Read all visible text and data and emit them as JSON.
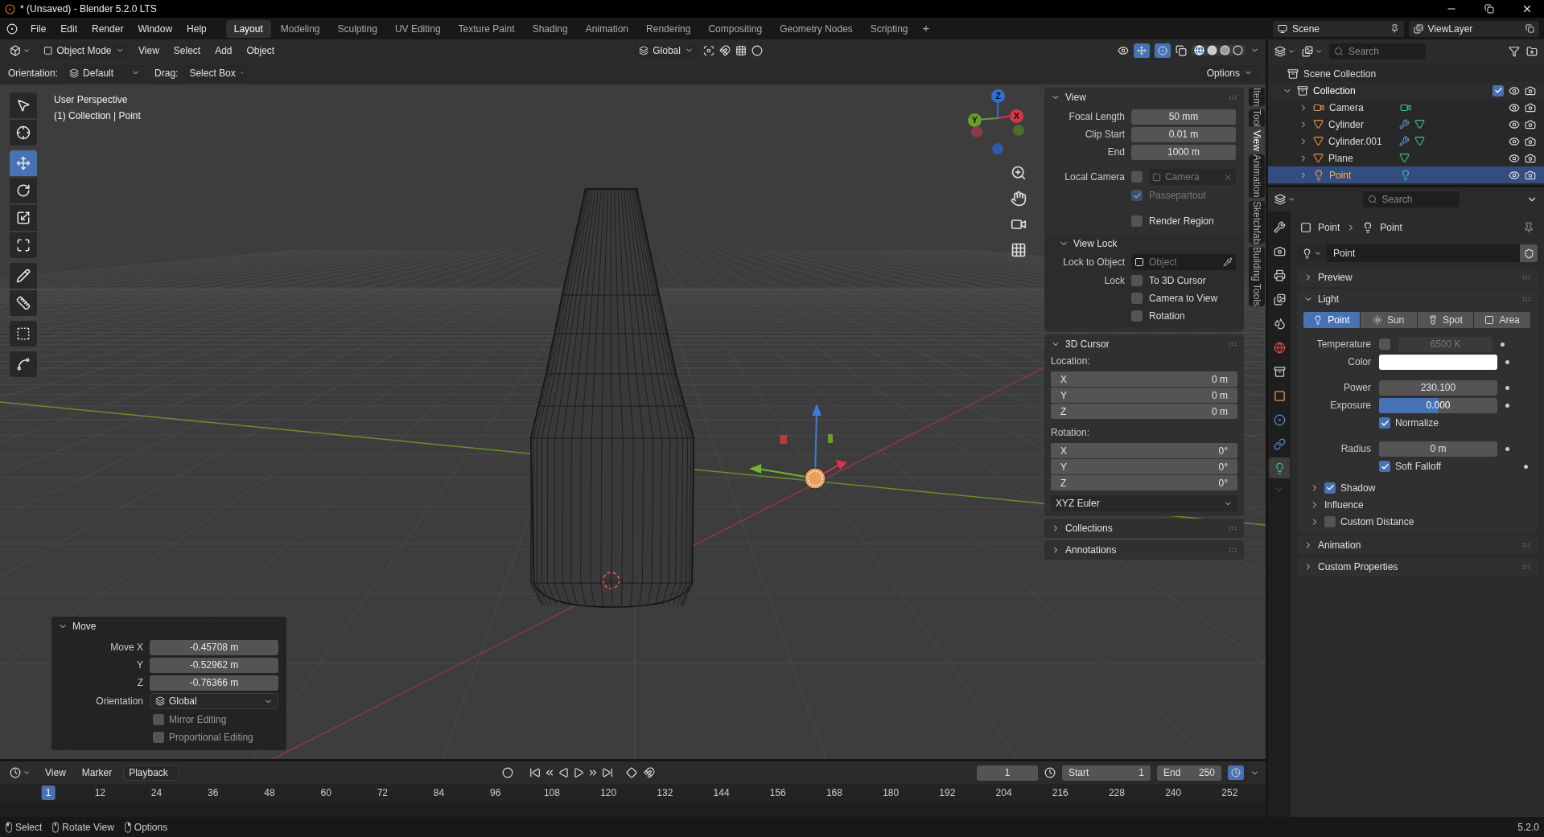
{
  "window": {
    "title": "* (Unsaved) - Blender 5.2.0 LTS"
  },
  "menus": [
    "File",
    "Edit",
    "Render",
    "Window",
    "Help"
  ],
  "workspaces": [
    {
      "label": "Layout",
      "selected": true
    },
    {
      "label": "Modeling",
      "selected": false
    },
    {
      "label": "Sculpting",
      "selected": false
    },
    {
      "label": "UV Editing",
      "selected": false
    },
    {
      "label": "Texture Paint",
      "selected": false
    },
    {
      "label": "Shading",
      "selected": false
    },
    {
      "label": "Animation",
      "selected": false
    },
    {
      "label": "Rendering",
      "selected": false
    },
    {
      "label": "Compositing",
      "selected": false
    },
    {
      "label": "Geometry Nodes",
      "selected": false
    },
    {
      "label": "Scripting",
      "selected": false
    }
  ],
  "add_workspace": "+",
  "scene": "Scene",
  "view_layer": "ViewLayer",
  "viewport_header": {
    "mode": "Object Mode",
    "menus": [
      "View",
      "Select",
      "Add",
      "Object"
    ],
    "transform_orientation": "Global"
  },
  "tool_settings": {
    "orientation_label": "Orientation:",
    "orientation": "Default",
    "drag_label": "Drag:",
    "drag": "Select Box",
    "options": "Options"
  },
  "toolbar": [
    [
      {
        "kind": "select",
        "selected": false
      },
      {
        "kind": "cursor",
        "selected": false
      }
    ],
    [
      {
        "kind": "move",
        "selected": true
      },
      {
        "kind": "rotate",
        "selected": false
      },
      {
        "kind": "scale",
        "selected": false
      },
      {
        "kind": "transform",
        "selected": false
      }
    ],
    [
      {
        "kind": "annotate",
        "selected": false
      },
      {
        "kind": "measure",
        "selected": false
      }
    ],
    [
      {
        "kind": "add_cube",
        "selected": false
      }
    ],
    [
      {
        "kind": "extrude_curve",
        "selected": false
      }
    ]
  ],
  "viewport_text": [
    "User Perspective",
    "(1) Collection | Point"
  ],
  "nav_axes": [
    {
      "label": "Z",
      "color": "#2f6fd6"
    },
    {
      "label": "Y",
      "color": "#6b9e2a"
    },
    {
      "label": "X",
      "color": "#d8344a"
    }
  ],
  "sidebar_tabs": [
    {
      "label": "Item",
      "selected": false
    },
    {
      "label": "Tool",
      "selected": false
    },
    {
      "label": "View",
      "selected": true
    },
    {
      "label": "Animation",
      "selected": false
    },
    {
      "label": "Sketchfab",
      "selected": false
    },
    {
      "label": "Building Tools",
      "selected": false
    }
  ],
  "view_panel": {
    "title": "View",
    "expanded": true,
    "lens": [
      {
        "label": "Focal Length",
        "value": "50 mm"
      },
      {
        "label": "Clip Start",
        "value": "0.01 m"
      },
      {
        "label": "End",
        "value": "1000 m"
      }
    ],
    "local_camera": {
      "label": "Local Camera",
      "checked": false,
      "placeholder": "Camera"
    },
    "passepartout": {
      "label": "Passepartout",
      "checked": true,
      "disabled": true
    },
    "render_region": {
      "label": "Render Region",
      "checked": false
    },
    "view_lock": {
      "title": "View Lock",
      "expanded": true,
      "lock_to_object_label": "Lock to Object",
      "object_placeholder": "Object",
      "lock_label": "Lock",
      "options": [
        {
          "label": "To 3D Cursor",
          "checked": false
        },
        {
          "label": "Camera to View",
          "checked": false
        },
        {
          "label": "Rotation",
          "checked": false
        }
      ]
    }
  },
  "cursor_panel": {
    "title": "3D Cursor",
    "expanded": true,
    "location_label": "Location:",
    "location": [
      {
        "axis": "X",
        "value": "0 m"
      },
      {
        "axis": "Y",
        "value": "0 m"
      },
      {
        "axis": "Z",
        "value": "0 m"
      }
    ],
    "rotation_label": "Rotation:",
    "rotation": [
      {
        "axis": "X",
        "value": "0°"
      },
      {
        "axis": "Y",
        "value": "0°"
      },
      {
        "axis": "Z",
        "value": "0°"
      }
    ],
    "rotation_mode": "XYZ Euler"
  },
  "sidebar_collapsed_panels": [
    {
      "title": "Collections",
      "expanded": false
    },
    {
      "title": "Annotations",
      "expanded": false
    }
  ],
  "move_panel": {
    "title": "Move",
    "expanded": true,
    "values": [
      {
        "label": "Move X",
        "value": "-0.45708 m"
      },
      {
        "label": "Y",
        "value": "-0.52962 m"
      },
      {
        "label": "Z",
        "value": "-0.76366 m"
      }
    ],
    "orientation_label": "Orientation",
    "orientation": "Global",
    "options": [
      {
        "label": "Mirror Editing",
        "checked": false
      },
      {
        "label": "Proportional Editing",
        "checked": false
      }
    ]
  },
  "outliner": {
    "search_placeholder": "Search",
    "root": "Scene Collection",
    "collection": {
      "name": "Collection",
      "expanded": true,
      "checked": true,
      "children": [
        {
          "name": "Camera",
          "kind": "camera",
          "selected": false,
          "has_modifier": false
        },
        {
          "name": "Cylinder",
          "kind": "mesh",
          "selected": false,
          "has_modifier": true
        },
        {
          "name": "Cylinder.001",
          "kind": "mesh",
          "selected": false,
          "has_modifier": true
        },
        {
          "name": "Plane",
          "kind": "mesh",
          "selected": false,
          "has_modifier": false
        },
        {
          "name": "Point",
          "kind": "light",
          "selected": true,
          "has_modifier": false
        }
      ]
    }
  },
  "properties": {
    "search_placeholder": "Search",
    "tabs": [
      {
        "kind": "tool",
        "selected": false
      },
      {
        "kind": "render",
        "selected": false
      },
      {
        "kind": "output",
        "selected": false
      },
      {
        "kind": "view_layer",
        "selected": false
      },
      {
        "kind": "scene",
        "selected": false
      },
      {
        "kind": "world",
        "selected": false
      },
      {
        "kind": "collection",
        "selected": false
      },
      {
        "kind": "object",
        "selected": false
      },
      {
        "kind": "physics",
        "selected": false
      },
      {
        "kind": "constraints",
        "selected": false
      },
      {
        "kind": "data",
        "selected": true
      }
    ],
    "breadcrumb": [
      "Point",
      "Point"
    ],
    "datablock": "Point",
    "panels": [
      {
        "kind": "plain",
        "title": "Preview",
        "expanded": false
      },
      {
        "kind": "light",
        "title": "Light",
        "expanded": true
      },
      {
        "kind": "plain",
        "title": "Animation",
        "expanded": false
      },
      {
        "kind": "plain",
        "title": "Custom Properties",
        "expanded": false
      }
    ],
    "light": {
      "types": [
        {
          "kind": "point",
          "label": "Point",
          "selected": true
        },
        {
          "kind": "sun",
          "label": "Sun",
          "selected": false
        },
        {
          "kind": "spot",
          "label": "Spot",
          "selected": false
        },
        {
          "kind": "area",
          "label": "Area",
          "selected": false
        }
      ],
      "temperature": {
        "label": "Temperature",
        "checked": false,
        "value": "6500 K"
      },
      "color": {
        "label": "Color",
        "color": "#ffffff"
      },
      "power": {
        "label": "Power",
        "value": "230.100"
      },
      "exposure": {
        "label": "Exposure",
        "value": "0.000",
        "level": 0.5
      },
      "normalize": {
        "label": "Normalize",
        "checked": true
      },
      "radius": {
        "label": "Radius",
        "value": "0 m"
      },
      "soft_falloff": {
        "label": "Soft Falloff",
        "checked": true
      },
      "subpanels": [
        {
          "kind": "checkbox",
          "title": "Shadow",
          "expanded": false,
          "checked": true
        },
        {
          "kind": "plain",
          "title": "Influence",
          "expanded": false
        },
        {
          "kind": "checkbox",
          "title": "Custom Distance",
          "expanded": false,
          "checked": false
        }
      ]
    }
  },
  "timeline": {
    "menus": [
      "View",
      "Marker",
      "Playback"
    ],
    "current_frame": "1",
    "start_label": "Start",
    "start": "1",
    "end_label": "End",
    "end": "250",
    "ticks": [
      {
        "label": "1",
        "selected": true
      },
      {
        "label": "12",
        "selected": false
      },
      {
        "label": "24",
        "selected": false
      },
      {
        "label": "36",
        "selected": false
      },
      {
        "label": "48",
        "selected": false
      },
      {
        "label": "60",
        "selected": false
      },
      {
        "label": "72",
        "selected": false
      },
      {
        "label": "84",
        "selected": false
      },
      {
        "label": "96",
        "selected": false
      },
      {
        "label": "108",
        "selected": false
      },
      {
        "label": "120",
        "selected": false
      },
      {
        "label": "132",
        "selected": false
      },
      {
        "label": "144",
        "selected": false
      },
      {
        "label": "156",
        "selected": false
      },
      {
        "label": "168",
        "selected": false
      },
      {
        "label": "180",
        "selected": false
      },
      {
        "label": "192",
        "selected": false
      },
      {
        "label": "204",
        "selected": false
      },
      {
        "label": "216",
        "selected": false
      },
      {
        "label": "228",
        "selected": false
      },
      {
        "label": "240",
        "selected": false
      },
      {
        "label": "252",
        "selected": false
      }
    ]
  },
  "status_bar": {
    "hints": [
      {
        "kind": "left_mouse",
        "label": "Select"
      },
      {
        "kind": "middle_mouse",
        "label": "Rotate View"
      },
      {
        "kind": "right_mouse",
        "label": "Options"
      }
    ],
    "version": "5.2.0"
  }
}
